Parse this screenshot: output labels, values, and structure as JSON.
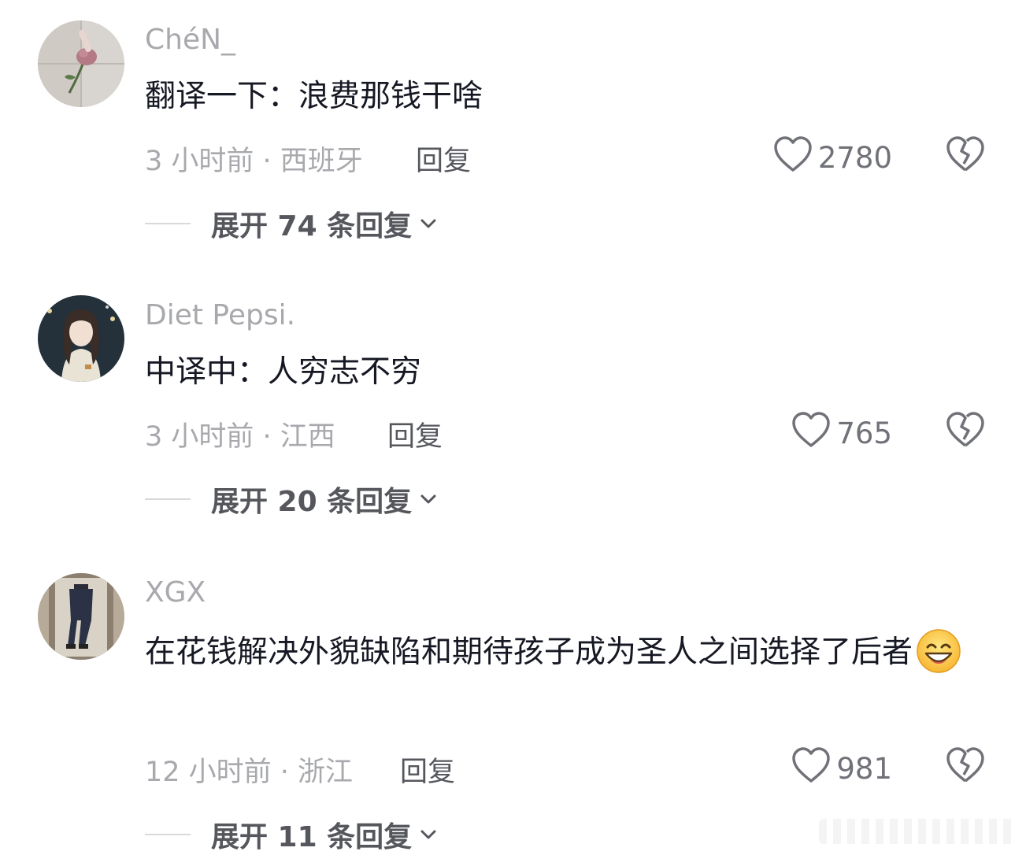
{
  "comments": [
    {
      "username": "ChéN_",
      "text": "翻译一下：浪费那钱干啥",
      "time_location": "3 小时前 · 西班牙",
      "reply_label": "回复",
      "likes": "2780",
      "expand_label": "展开 74 条回复"
    },
    {
      "username": "Diet Pepsi.",
      "text": "中译中：人穷志不穷",
      "time_location": "3 小时前 · 江西",
      "reply_label": "回复",
      "likes": "765",
      "expand_label": "展开 20 条回复"
    },
    {
      "username": "XGX",
      "text": "在花钱解决外貌缺陷和期待孩子成为圣人之间选择了后者",
      "emoji": "grinning-sweat-emoji",
      "time_location": "12 小时前 · 浙江",
      "reply_label": "回复",
      "likes": "981",
      "expand_label": "展开 11 条回复"
    }
  ],
  "colors": {
    "primary_text": "#161823",
    "secondary_text": "#a8a9ad",
    "action_text": "#55575d",
    "icon": "#707278"
  }
}
